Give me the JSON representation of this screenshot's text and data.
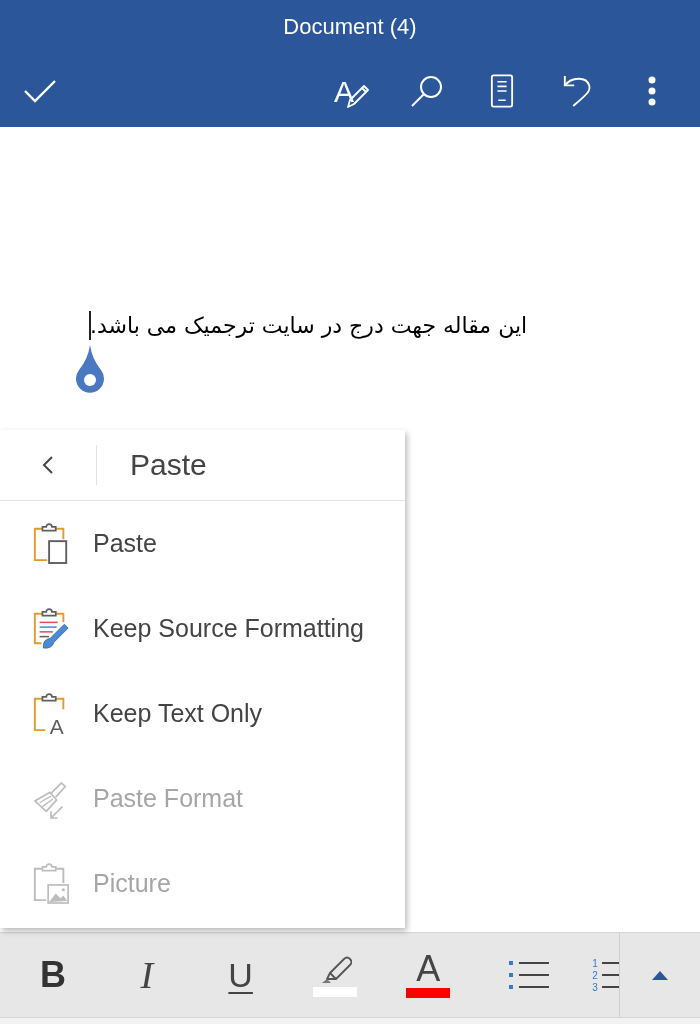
{
  "header": {
    "title": "Document (4)",
    "actions": [
      {
        "kind": "done"
      },
      {
        "kind": "proofing",
        "glyph": "A"
      },
      {
        "kind": "search"
      },
      {
        "kind": "reading_view"
      },
      {
        "kind": "undo"
      },
      {
        "kind": "more"
      }
    ]
  },
  "document": {
    "paragraph": "این مقاله جهت درج در سایت ترجمیک می باشد."
  },
  "paste_menu": {
    "title": "Paste",
    "items": [
      {
        "kind": "paste",
        "label": "Paste",
        "disabled": false
      },
      {
        "kind": "keep_source",
        "label": "Keep Source Formatting",
        "disabled": false
      },
      {
        "kind": "keep_text",
        "label": "Keep Text Only",
        "glyph": "A",
        "disabled": false
      },
      {
        "kind": "paste_format",
        "label": "Paste Format",
        "disabled": true
      },
      {
        "kind": "picture",
        "label": "Picture",
        "disabled": true
      }
    ]
  },
  "format_toolbar": {
    "buttons": [
      {
        "kind": "bold",
        "glyph": "B"
      },
      {
        "kind": "italic",
        "glyph": "I"
      },
      {
        "kind": "underline",
        "glyph": "U"
      },
      {
        "kind": "highlight",
        "color": "#ffffff"
      },
      {
        "kind": "font_color",
        "glyph": "A",
        "color": "#ff0000"
      },
      {
        "kind": "bullets"
      },
      {
        "kind": "numbering",
        "glyphs": [
          "1",
          "2",
          "3"
        ]
      },
      {
        "kind": "expand"
      }
    ]
  }
}
